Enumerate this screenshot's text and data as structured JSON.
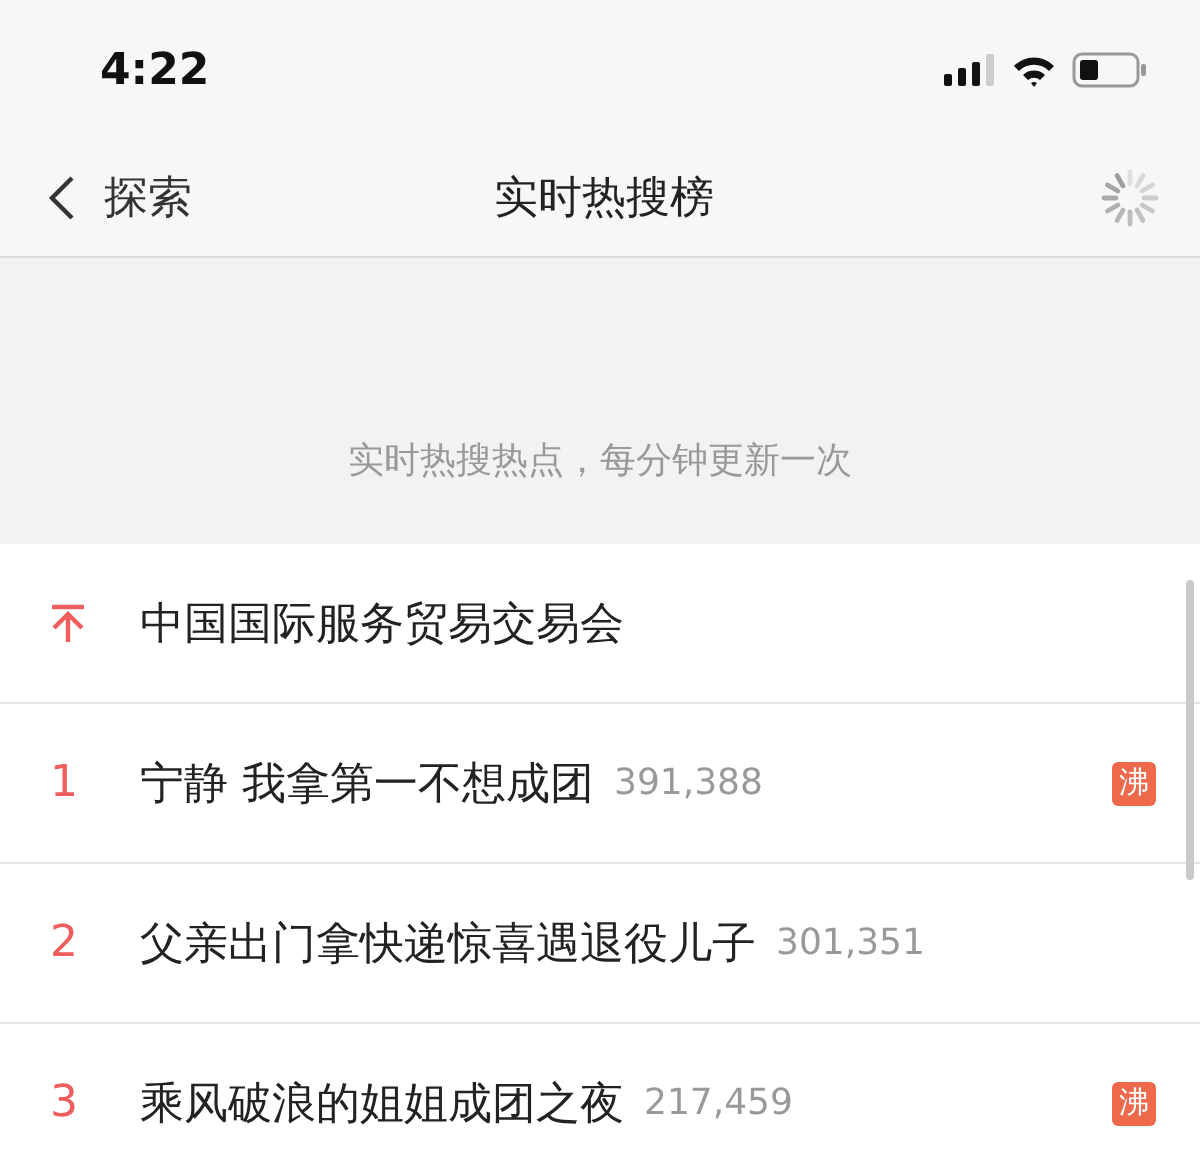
{
  "status_bar": {
    "time": "4:22"
  },
  "nav": {
    "back_label": "探索",
    "title": "实时热搜榜"
  },
  "banner": {
    "text": "实时热搜热点，每分钟更新一次"
  },
  "rows": [
    {
      "kind": "pinned",
      "title": "中国国际服务贸易交易会"
    },
    {
      "kind": "ranked",
      "rank": "1",
      "title": "宁静 我拿第一不想成团",
      "count": "391,388",
      "badge": {
        "text": "沸",
        "kind": "hot"
      }
    },
    {
      "kind": "ranked",
      "rank": "2",
      "title": "父亲出门拿快递惊喜遇退役儿子",
      "count": "301,351"
    },
    {
      "kind": "ranked",
      "rank": "3",
      "title": "乘风破浪的姐姐成团之夜",
      "count": "217,459",
      "badge": {
        "text": "沸",
        "kind": "hot"
      }
    }
  ]
}
